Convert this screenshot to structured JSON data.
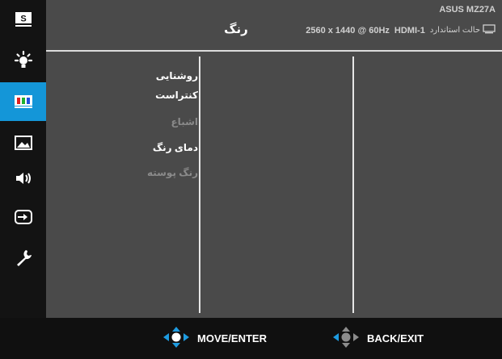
{
  "header": {
    "title": "رنگ",
    "model": "ASUS MZ27A",
    "input": "HDMI-1",
    "resolution": "2560 x 1440 @ 60Hz",
    "mode": "حالت استاندارد"
  },
  "sidebar": {
    "items": [
      {
        "icon": "splendid-icon",
        "active": false
      },
      {
        "icon": "brightness-icon",
        "active": false
      },
      {
        "icon": "color-icon",
        "active": true
      },
      {
        "icon": "image-icon",
        "active": false
      },
      {
        "icon": "sound-icon",
        "active": false
      },
      {
        "icon": "input-select-icon",
        "active": false
      },
      {
        "icon": "system-setup-icon",
        "active": false
      }
    ]
  },
  "menu": {
    "items": [
      {
        "label": "روشنایی",
        "enabled": true
      },
      {
        "label": "کنتراست",
        "enabled": true
      },
      {
        "label": "اشباع",
        "enabled": false
      },
      {
        "label": "دمای رنگ",
        "enabled": true
      },
      {
        "label": "رنگ پوسته",
        "enabled": false
      }
    ]
  },
  "footer": {
    "move_label": "MOVE/ENTER",
    "back_label": "BACK/EXIT"
  },
  "colors": {
    "accent": "#1496d8",
    "panel": "#4a4a4a",
    "sidebar": "#131313",
    "disabled_text": "#8a8a8a"
  }
}
